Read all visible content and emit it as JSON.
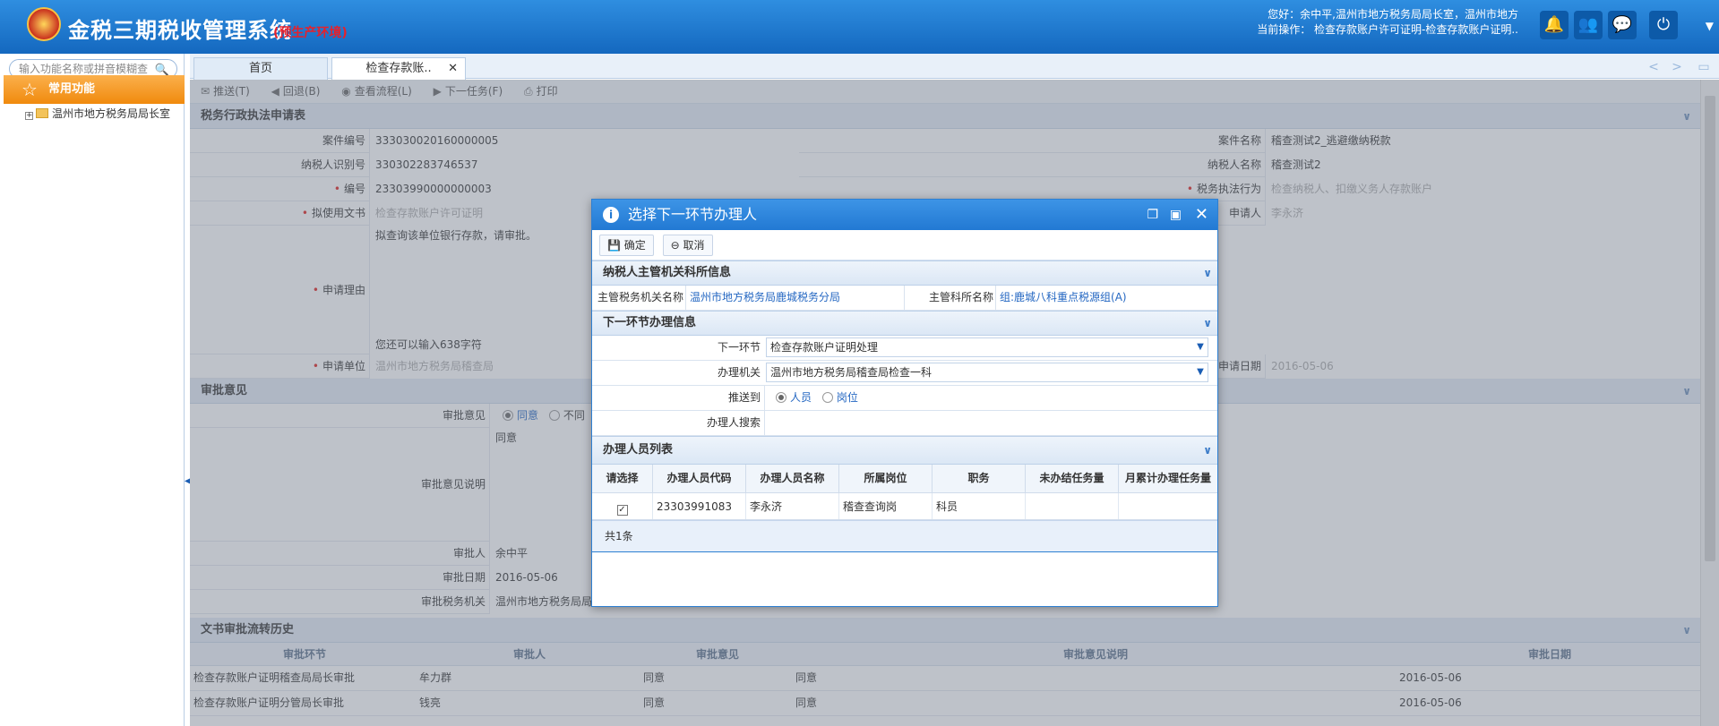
{
  "header": {
    "app_title": "金税三期税收管理系统",
    "env_tag": "(预生产环境)",
    "greeting": "您好：余中平,温州市地方税务局局长室，温州市地方",
    "current_op": "当前操作：  检查存款账户许可证明-检查存款账户证明..",
    "icons": [
      "bell-icon",
      "users-icon",
      "chat-icon",
      "power-icon"
    ]
  },
  "sidebar": {
    "search_placeholder": "输入功能名称或拼音模糊查",
    "common_label": "常用功能",
    "tree_item": "温州市地方税务局局长室"
  },
  "tabs": [
    {
      "label": "首页"
    },
    {
      "label": "检查存款账.."
    }
  ],
  "toolbar": {
    "push": "推送(T)",
    "back": "回退(B)",
    "view_flow": "查看流程(L)",
    "next_task": "下一任务(F)",
    "print": "打印"
  },
  "form": {
    "section_title": "税务行政执法申请表",
    "case_no_label": "案件编号",
    "case_no": "333030020160000005",
    "case_name_label": "案件名称",
    "case_name": "稽查测试2_逃避缴纳税款",
    "tax_id_label": "纳税人识别号",
    "tax_id": "330302283746537",
    "tax_name_label": "纳税人名称",
    "tax_name": "稽查测试2",
    "serial_label": "编号",
    "serial": "23303990000000003",
    "action_label": "税务执法行为",
    "action": "检查纳税人、扣缴义务人存款账户",
    "doc_label": "拟使用文书",
    "doc": "检查存款账户许可证明",
    "applicant_label": "申请人",
    "applicant": "李永济",
    "reason_label": "申请理由",
    "reason": "拟查询该单位银行存款，请审批。",
    "remaining": "您还可以输入638字符",
    "unit_label": "申请单位",
    "unit": "温州市地方税务局稽查局",
    "date_label": "申请日期",
    "date": "2016-05-06"
  },
  "approval": {
    "section_title": "审批意见",
    "opinion_label": "审批意见",
    "agree": "同意",
    "disagree": "不同",
    "desc_label": "审批意见说明",
    "desc": "同意",
    "approver_label": "审批人",
    "approver": "余中平",
    "date_label": "审批日期",
    "date": "2016-05-06",
    "org_label": "审批税务机关",
    "org": "温州市地方税务局局长室"
  },
  "history": {
    "section_title": "文书审批流转历史",
    "headers": [
      "审批环节",
      "审批人",
      "审批意见",
      "审批意见说明",
      "审批日期"
    ],
    "rows": [
      [
        "检查存款账户证明稽查局局长审批",
        "牟力群",
        "同意",
        "同意",
        "2016-05-06"
      ],
      [
        "检查存款账户证明分管局长审批",
        "钱亮",
        "同意",
        "同意",
        "2016-05-06"
      ]
    ]
  },
  "dialog": {
    "title": "选择下一环节办理人",
    "confirm": "确定",
    "cancel": "取消",
    "sec1_title": "纳税人主管机关科所信息",
    "auth_label": "主管税务机关名称",
    "auth": "温州市地方税务局鹿城税务分局",
    "dept_label": "主管科所名称",
    "dept": "组:鹿城八科重点税源组(A)",
    "sec2_title": "下一环节办理信息",
    "next_step_label": "下一环节",
    "next_step": "检查存款账户证明处理",
    "office_label": "办理机关",
    "office": "温州市地方税务局稽查局检查一科",
    "push_to_label": "推送到",
    "push_person": "人员",
    "push_post": "岗位",
    "search_label": "办理人搜索",
    "sec3_title": "办理人员列表",
    "grid_headers": [
      "请选择",
      "办理人员代码",
      "办理人员名称",
      "所属岗位",
      "职务",
      "未办结任务量",
      "月累计办理任务量"
    ],
    "grid_row": {
      "check": "✓",
      "code": "23303991083",
      "name": "李永济",
      "post": "稽查查询岗",
      "title": "科员",
      "pending": "",
      "monthly": ""
    },
    "total": "共1条"
  }
}
